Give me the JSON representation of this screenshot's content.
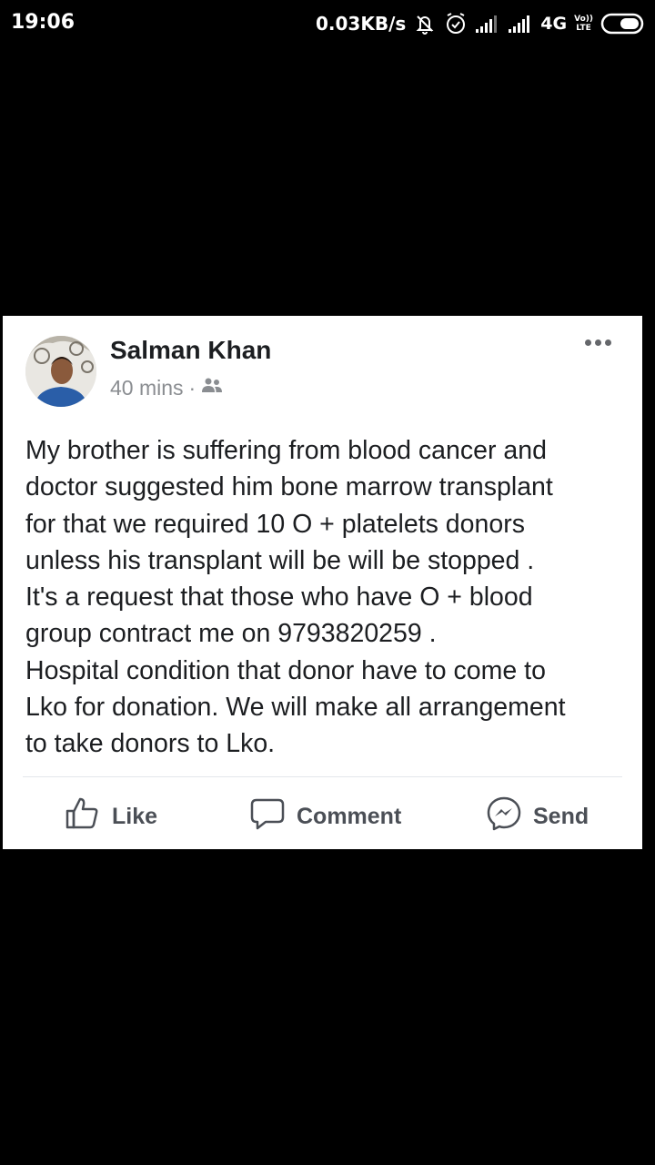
{
  "status_bar": {
    "time": "19:06",
    "net_speed": "0.03KB/s",
    "network_type": "4G",
    "volte_top": "Vo))",
    "volte_bottom": "LTE",
    "icons": [
      "mute-icon",
      "alarm-icon",
      "signal-icon",
      "signal-icon",
      "battery-icon"
    ]
  },
  "post": {
    "author": "Salman Khan",
    "timestamp": "40 mins",
    "separator": "·",
    "audience_icon": "friends-icon",
    "body": "My brother is suffering from blood cancer and\ndoctor suggested him bone marrow transplant\nfor that we required 10 O + platelets donors\nunless his transplant will be will be stopped .\nIt's a request that those who have O + blood\ngroup contract me on 9793820259 .\nHospital condition that donor have to come to\nLko for donation. We will make all arrangement\nto take donors to Lko.",
    "actions": {
      "like": "Like",
      "comment": "Comment",
      "send": "Send"
    }
  },
  "colors": {
    "background": "#000000",
    "card": "#ffffff",
    "text": "#1c1e21",
    "meta": "#8a8d91",
    "action": "#4b4f56"
  }
}
